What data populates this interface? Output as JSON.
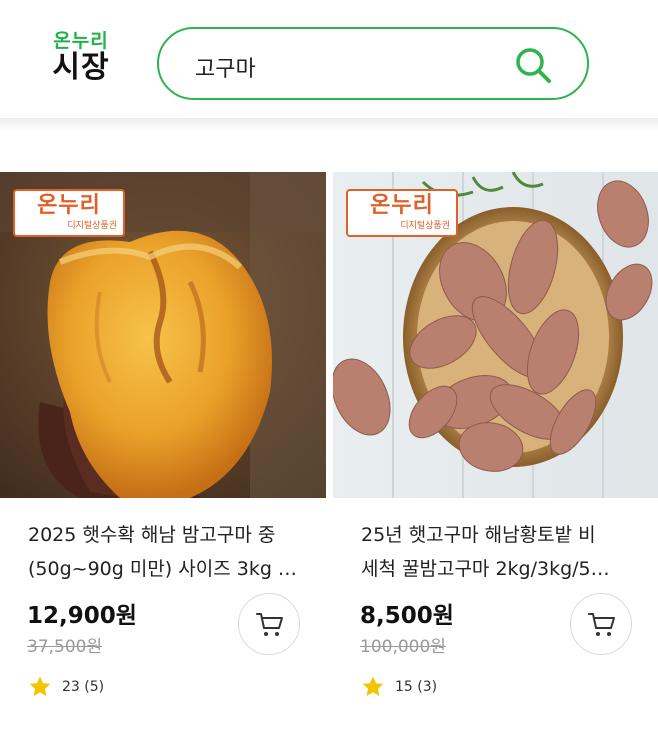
{
  "header": {
    "logo_top": "온누리",
    "logo_bottom": "시장",
    "search_query": "고구마"
  },
  "colors": {
    "brand_green": "#21b24b",
    "badge_orange": "#e0602a",
    "star_yellow": "#f5c400"
  },
  "badge": {
    "main": "온누리",
    "sub": "디지털상품권"
  },
  "products": [
    {
      "title_line1": "2025 햇수확 해남 밤고구마 중",
      "title_line2": "(50g~90g 미만) 사이즈 3kg …",
      "price": "12,900원",
      "original_price": "37,500원",
      "rating_text": "23 (5)",
      "image": "baked-sweet-potato-photo"
    },
    {
      "title_line1": "25년 햇고구마 해남황토밭 비",
      "title_line2": "세척 꿀밤고구마 2kg/3kg/5…",
      "price": "8,500원",
      "original_price": "100,000원",
      "rating_text": "15 (3)",
      "image": "sweet-potatoes-in-basket-photo"
    }
  ]
}
